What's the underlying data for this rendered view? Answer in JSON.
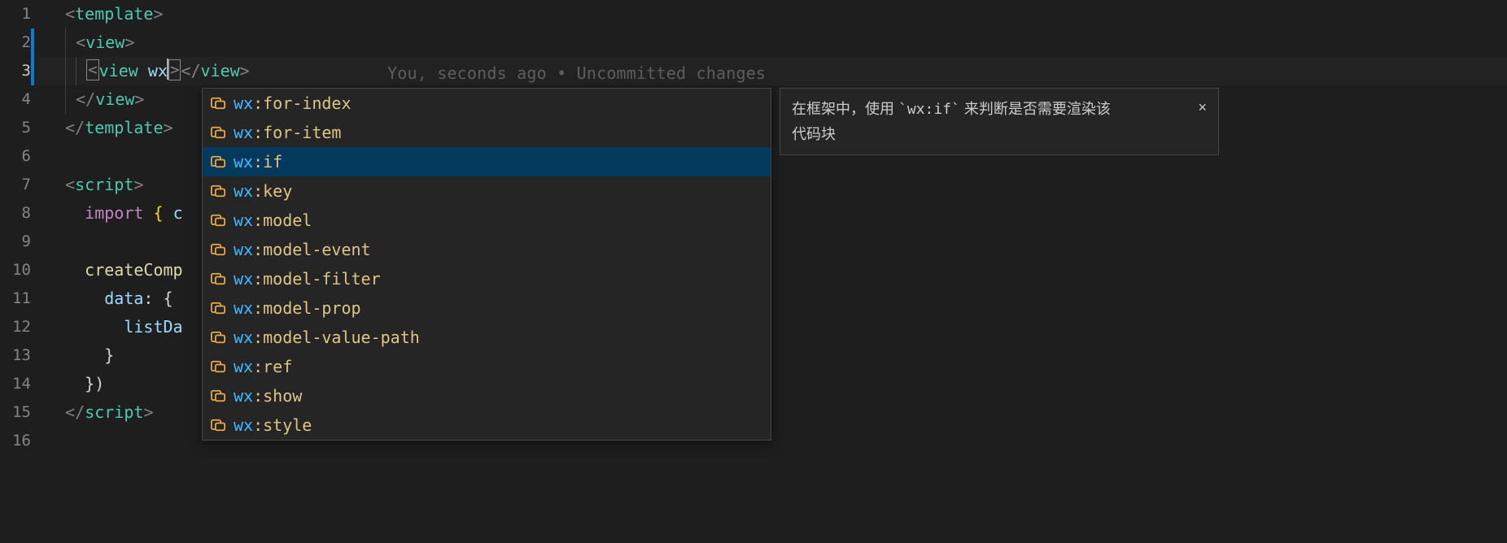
{
  "gutter": {
    "lines": [
      "1",
      "2",
      "3",
      "4",
      "5",
      "6",
      "7",
      "8",
      "9",
      "10",
      "11",
      "12",
      "13",
      "14",
      "15",
      "16"
    ],
    "activeLine": 3
  },
  "code": {
    "line1": {
      "open": "<",
      "tag": "template",
      "close": ">"
    },
    "line2": {
      "open": "<",
      "tag": "view",
      "close": ">"
    },
    "line3": {
      "open": "<",
      "tag": "view",
      "attr": "wx",
      "endOpen": "</",
      "endTag": "view",
      "endClose": ">"
    },
    "line4": {
      "open": "</",
      "tag": "view",
      "close": ">"
    },
    "line5": {
      "open": "</",
      "tag": "template",
      "close": ">"
    },
    "line7": {
      "open": "<",
      "tag": "script",
      "close": ">"
    },
    "line8": {
      "kw": "import",
      "brace": "{",
      "id": "c"
    },
    "line10": {
      "fn": "createComp"
    },
    "line11": {
      "key": "data",
      "colon": ":",
      "brace": "{"
    },
    "line12": {
      "key": "listDa"
    },
    "line13": {
      "brace": "}"
    },
    "line14": {
      "brace": "}",
      "paren": ")"
    },
    "line15": {
      "open": "</",
      "tag": "script",
      "close": ">"
    }
  },
  "codelens": {
    "author": "You, seconds ago",
    "sep": " • ",
    "msg": "Uncommitted changes"
  },
  "suggest": {
    "items": [
      {
        "hl": "wx",
        "rest": ":for-index"
      },
      {
        "hl": "wx",
        "rest": ":for-item"
      },
      {
        "hl": "wx",
        "rest": ":if"
      },
      {
        "hl": "wx",
        "rest": ":key"
      },
      {
        "hl": "wx",
        "rest": ":model"
      },
      {
        "hl": "wx",
        "rest": ":model-event"
      },
      {
        "hl": "wx",
        "rest": ":model-filter"
      },
      {
        "hl": "wx",
        "rest": ":model-prop"
      },
      {
        "hl": "wx",
        "rest": ":model-value-path"
      },
      {
        "hl": "wx",
        "rest": ":ref"
      },
      {
        "hl": "wx",
        "rest": ":show"
      },
      {
        "hl": "wx",
        "rest": ":style"
      }
    ],
    "selectedIndex": 2
  },
  "doc": {
    "text_pre": "在框架中，使用 ",
    "code": "`wx:if`",
    "text_mid": " 来判断是否需要渲染该",
    "text_line2": "代码块",
    "close": "×"
  }
}
